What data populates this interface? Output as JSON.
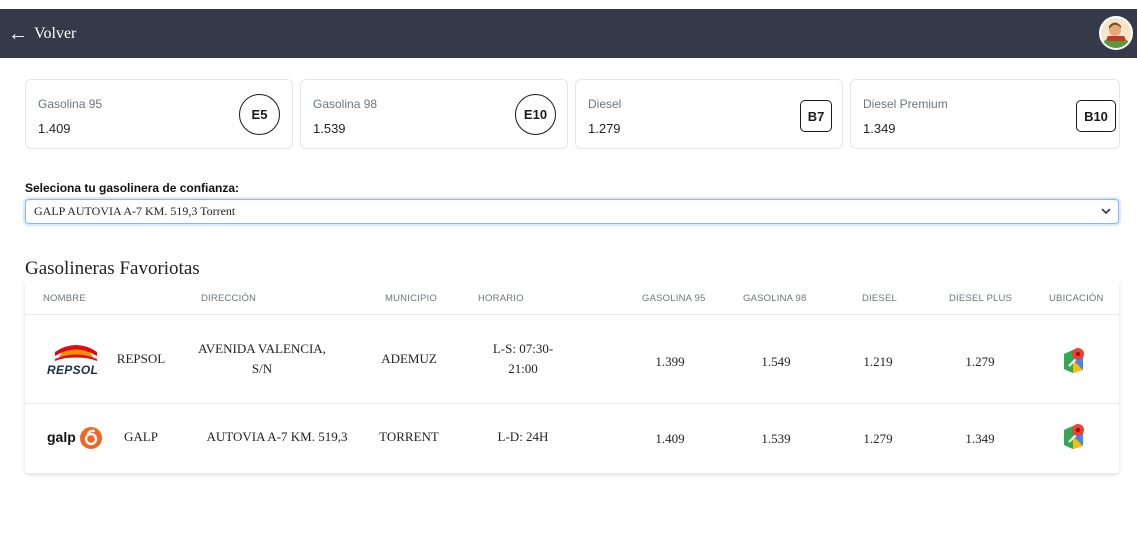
{
  "header": {
    "back_label": "Volver"
  },
  "fuel_cards": [
    {
      "name": "Gasolina 95",
      "price": "1.409",
      "badge": "E5"
    },
    {
      "name": "Gasolina 98",
      "price": "1.539",
      "badge": "E10"
    },
    {
      "name": "Diesel",
      "price": "1.279",
      "badge": "B7"
    },
    {
      "name": "Diesel Premium",
      "price": "1.349",
      "badge": "B10"
    }
  ],
  "selector": {
    "label": "Seleciona tu gasolinera de confianza:",
    "selected": "GALP AUTOVIA A-7 KM. 519,3 Torrent"
  },
  "favorites": {
    "title": "Gasolineras Favoriotas",
    "columns": [
      "NOMBRE",
      "DIRECCIÓN",
      "MUNICIPIO",
      "HORARIO",
      "GASOLINA 95",
      "GASOLINA 98",
      "DIESEL",
      "DIESEL PLUS",
      "UBICACIÓN"
    ],
    "rows": [
      {
        "logo_text": "REPSOL",
        "name": "REPSOL",
        "address": "AVENIDA VALENCIA, S/N",
        "municipality": "ADEMUZ",
        "schedule": "L-S: 07:30-21:00",
        "g95": "1.399",
        "g98": "1.549",
        "diesel": "1.219",
        "diesel_plus": "1.279"
      },
      {
        "logo_text": "galp",
        "name": "GALP",
        "address": "AUTOVIA A-7 KM. 519,3",
        "municipality": "TORRENT",
        "schedule": "L-D: 24H",
        "g95": "1.409",
        "g98": "1.539",
        "diesel": "1.279",
        "diesel_plus": "1.349"
      }
    ]
  },
  "colors": {
    "topbar": "#343a4a",
    "repsol_orange": "#f39200",
    "repsol_red": "#e30613",
    "repsol_navy": "#1a2c5b",
    "galp_orange": "#f26522"
  }
}
